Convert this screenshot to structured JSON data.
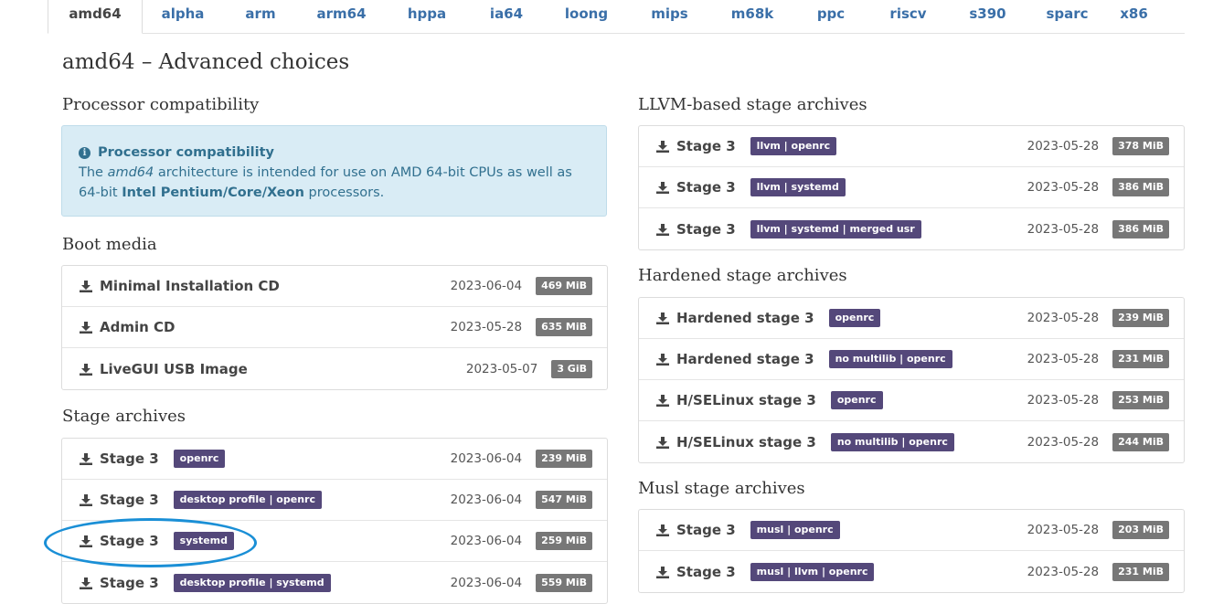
{
  "tabs": [
    "amd64",
    "alpha",
    "arm",
    "arm64",
    "hppa",
    "ia64",
    "loong",
    "mips",
    "m68k",
    "ppc",
    "riscv",
    "s390",
    "sparc",
    "x86"
  ],
  "page_title": "amd64 – Advanced choices",
  "processor": {
    "heading": "Processor compatibility",
    "info_icon": "info-circle-icon",
    "info_title": "Processor compatibility",
    "text_1": "The ",
    "arch": "amd64",
    "text_2": " architecture is intended for use on AMD 64-bit CPUs as well as 64-bit ",
    "cpus": "Intel Pentium/Core/Xeon",
    "text_3": " processors."
  },
  "boot_media": {
    "heading": "Boot media",
    "items": [
      {
        "name": "Minimal Installation CD",
        "date": "2023-06-04",
        "size": "469 MiB"
      },
      {
        "name": "Admin CD",
        "date": "2023-05-28",
        "size": "635 MiB"
      },
      {
        "name": "LiveGUI USB Image",
        "date": "2023-05-07",
        "size": "3 GiB"
      }
    ]
  },
  "stage_archives": {
    "heading": "Stage archives",
    "items": [
      {
        "name": "Stage 3",
        "badge": "openrc",
        "date": "2023-06-04",
        "size": "239 MiB"
      },
      {
        "name": "Stage 3",
        "badge": "desktop profile | openrc",
        "date": "2023-06-04",
        "size": "547 MiB"
      },
      {
        "name": "Stage 3",
        "badge": "systemd",
        "date": "2023-06-04",
        "size": "259 MiB"
      },
      {
        "name": "Stage 3",
        "badge": "desktop profile | systemd",
        "date": "2023-06-04",
        "size": "559 MiB"
      }
    ]
  },
  "llvm": {
    "heading": "LLVM-based stage archives",
    "items": [
      {
        "name": "Stage 3",
        "badge": "llvm | openrc",
        "date": "2023-05-28",
        "size": "378 MiB"
      },
      {
        "name": "Stage 3",
        "badge": "llvm | systemd",
        "date": "2023-05-28",
        "size": "386 MiB"
      },
      {
        "name": "Stage 3",
        "badge": "llvm | systemd | merged usr",
        "date": "2023-05-28",
        "size": "386 MiB"
      }
    ]
  },
  "hardened": {
    "heading": "Hardened stage archives",
    "items": [
      {
        "name": "Hardened stage 3",
        "badge": "openrc",
        "date": "2023-05-28",
        "size": "239 MiB"
      },
      {
        "name": "Hardened stage 3",
        "badge": "no multilib | openrc",
        "date": "2023-05-28",
        "size": "231 MiB"
      },
      {
        "name": "H/SELinux stage 3",
        "badge": "openrc",
        "date": "2023-05-28",
        "size": "253 MiB"
      },
      {
        "name": "H/SELinux stage 3",
        "badge": "no multilib | openrc",
        "date": "2023-05-28",
        "size": "244 MiB"
      }
    ]
  },
  "musl": {
    "heading": "Musl stage archives",
    "items": [
      {
        "name": "Stage 3",
        "badge": "musl | openrc",
        "date": "2023-05-28",
        "size": "203 MiB"
      },
      {
        "name": "Stage 3",
        "badge": "musl | llvm | openrc",
        "date": "2023-05-28",
        "size": "231 MiB"
      }
    ]
  },
  "colors": {
    "link": "#3a6fa8",
    "badge": "#54487a",
    "size_badge": "#777777",
    "info_bg": "#d9ecf5",
    "annotation": "#1a8fd6"
  }
}
